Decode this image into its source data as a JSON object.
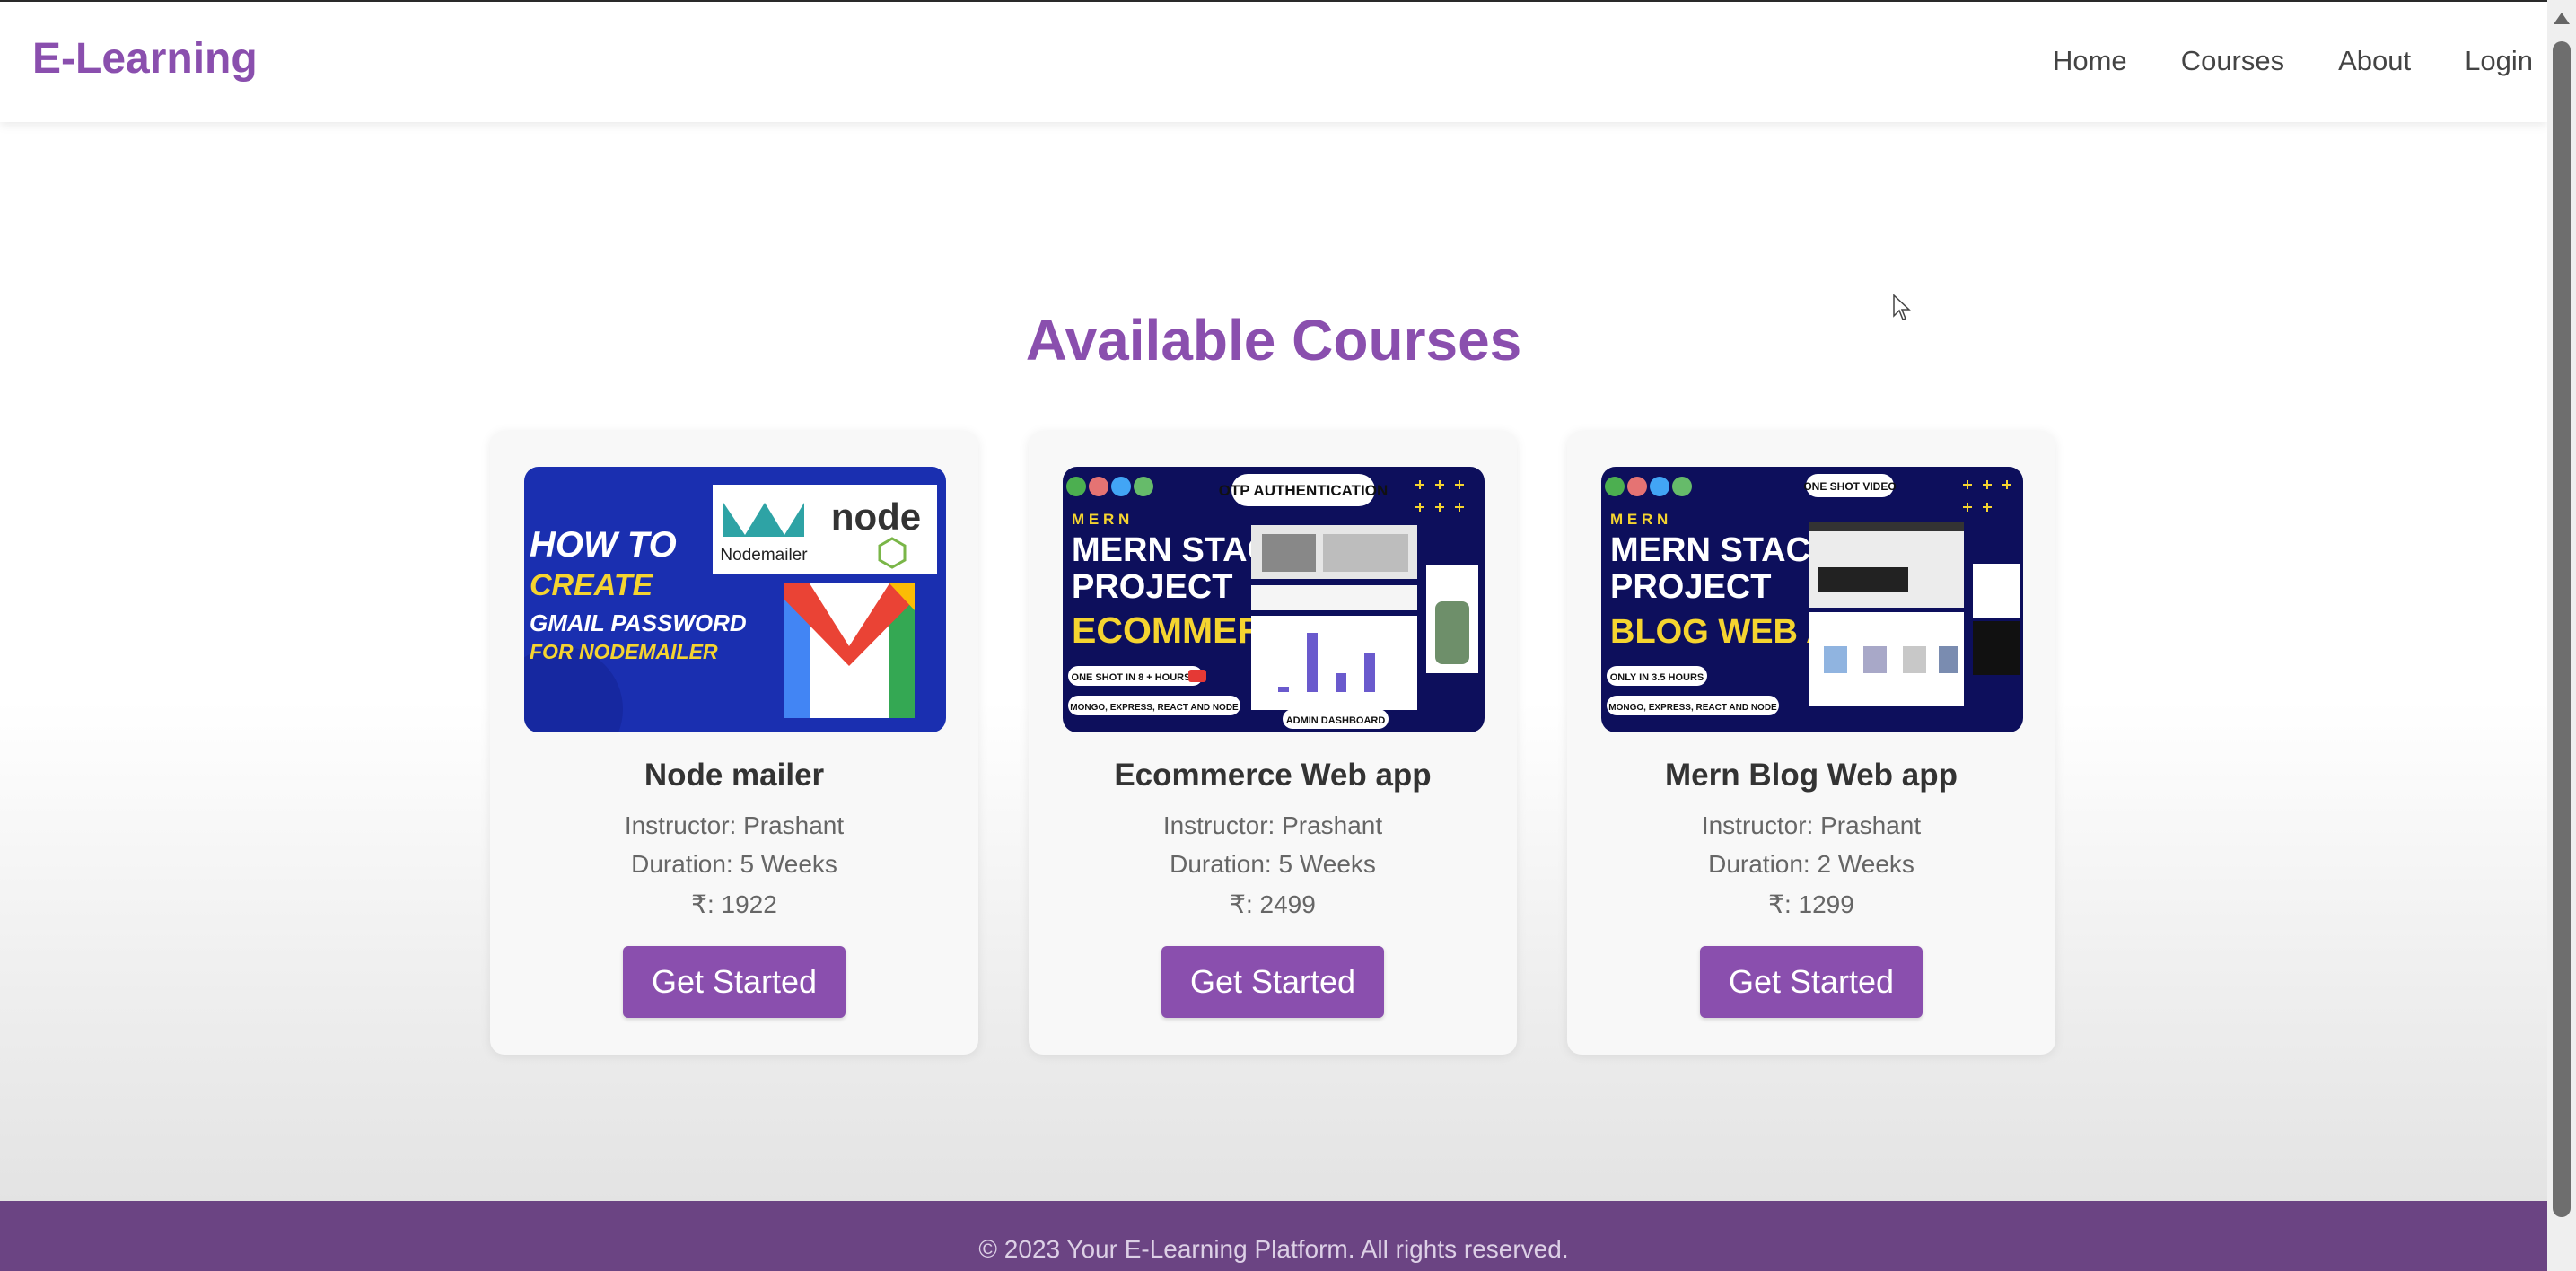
{
  "header": {
    "brand": "E-Learning",
    "nav": [
      "Home",
      "Courses",
      "About",
      "Login"
    ]
  },
  "main": {
    "heading": "Available Courses",
    "courses": [
      {
        "title": "Node mailer",
        "instructor": "Instructor: Prashant",
        "duration": "Duration: 5 Weeks",
        "price": "₹: 1922",
        "button": "Get Started",
        "thumbnail": {
          "line1": "HOW TO",
          "line2": "CREATE",
          "line3": "GMAIL PASSWORD",
          "line4": "FOR NODEMAILER",
          "badge1": "Nodemailer",
          "badge2": "node"
        }
      },
      {
        "title": "Ecommerce Web app",
        "instructor": "Instructor: Prashant",
        "duration": "Duration: 5 Weeks",
        "price": "₹: 2499",
        "button": "Get Started",
        "thumbnail": {
          "tag": "OTP AUTHENTICATION",
          "stack": "M E R N",
          "line1": "MERN STACK",
          "line2": "PROJECT",
          "line3": "ECOMMERCE",
          "pill1": "ONE SHOT IN 8 + HOURS",
          "pill2": "MONGO, EXPRESS, REACT AND NODE",
          "pill3": "ADMIN DASHBOARD"
        }
      },
      {
        "title": "Mern Blog Web app",
        "instructor": "Instructor: Prashant",
        "duration": "Duration: 2 Weeks",
        "price": "₹: 1299",
        "button": "Get Started",
        "thumbnail": {
          "tag": "ONE SHOT VIDEO",
          "stack": "M E R N",
          "line1": "MERN STACK",
          "line2": "PROJECT",
          "line3": "BLOG WEB APP",
          "pill1": "ONLY IN 3.5 HOURS",
          "pill2": "MONGO, EXPRESS, REACT AND NODE"
        }
      }
    ]
  },
  "footer": {
    "text": "© 2023 Your E-Learning Platform. All rights reserved."
  },
  "colors": {
    "accent": "#8a4fae",
    "footer_bg": "#6b4483",
    "thumb_navy": "#0d0f5c",
    "thumb_blue": "#1a2fb0",
    "thumb_yellow": "#f5d430"
  }
}
